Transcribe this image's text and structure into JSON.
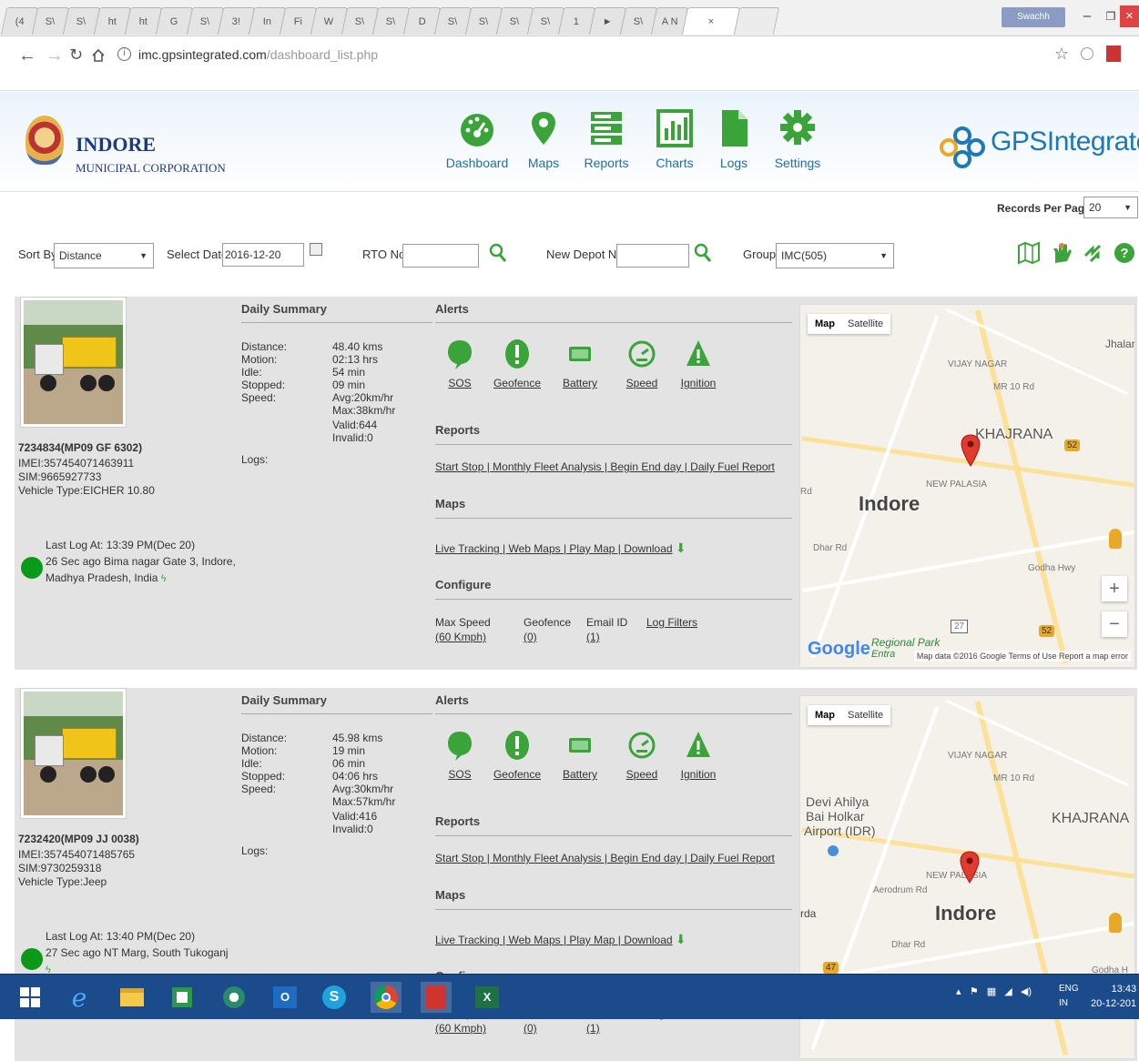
{
  "browser": {
    "tabs": [
      "(4",
      "S\\",
      "S\\",
      "ht",
      "ht",
      "G",
      "S\\",
      "3!",
      "In",
      "Fi",
      "W",
      "S\\",
      "S\\",
      "D",
      "S\\",
      "S\\",
      "S\\",
      "S\\",
      "1",
      "►",
      "S\\",
      "A N",
      "×"
    ],
    "profile": "Swachh",
    "url_host": "imc.gpsintegrated.com",
    "url_path": "/dashboard_list.php"
  },
  "header": {
    "org_title": "INDORE",
    "org_subtitle": "MUNICIPAL CORPORATION",
    "nav": [
      "Dashboard",
      "Maps",
      "Reports",
      "Charts",
      "Logs",
      "Settings"
    ],
    "brand": "GPSIntegrated",
    "nav_color": "#1f6fa6",
    "icon_color": "#3aa43a"
  },
  "toolbar": {
    "records_per_page_label": "Records Per Page:",
    "records_per_page_value": "20",
    "sort_by_label": "Sort By",
    "sort_by_value": "Distance",
    "select_date_label": "Select Date",
    "select_date_value": "2016-12-20",
    "rto_label": "RTO No",
    "depot_label": "New Depot No",
    "group_label": "Group",
    "group_value": "IMC(505)"
  },
  "vehicles": [
    {
      "id": "7234834(MP09 GF 6302)",
      "imei": "IMEI:357454071463911",
      "sim": "SIM:9665927733",
      "type": "Vehicle Type:EICHER 10.80",
      "last_log": "Last Log At: 13:39 PM(Dec 20)",
      "last_loc1": "26 Sec ago Bima nagar Gate 3, Indore,",
      "last_loc2": "Madhya Pradesh, India",
      "summary": {
        "distance": "48.40 kms",
        "motion": "02:13 hrs",
        "idle": "54 min",
        "stopped": "09 min",
        "speed_avg": "Avg:20km/hr",
        "speed_max": "Max:38km/hr",
        "logs_valid": "Valid:644",
        "logs_invalid": "Invalid:0"
      },
      "map": {
        "city": "Indore",
        "areas": [
          "KHAJRANA",
          "Jhalariya"
        ],
        "small": [
          "VIJAY NAGAR",
          "MR 10 Rd",
          "NEW PALASIA",
          "Godha Hwy",
          "Dhar Rd",
          "Rd"
        ],
        "park": "Regional Park",
        "park2": "Entra",
        "badges": [
          "52",
          "27",
          "52"
        ],
        "attribution": "Map data ©2016 Google   Terms of Use   Report a map error"
      }
    },
    {
      "id": "7232420(MP09 JJ 0038)",
      "imei": "IMEI:357454071485765",
      "sim": "SIM:9730259318",
      "type": "Vehicle Type:Jeep",
      "last_log": "Last Log At: 13:40 PM(Dec 20)",
      "last_loc1": "27 Sec ago NT Marg, South Tukoganj",
      "last_loc2": "",
      "summary": {
        "distance": "45.98 kms",
        "motion": "19 min",
        "idle": "06 min",
        "stopped": "04:06 hrs",
        "speed_avg": "Avg:30km/hr",
        "speed_max": "Max:57km/hr",
        "logs_valid": "Valid:416",
        "logs_invalid": "Invalid:0"
      },
      "map": {
        "city": "Indore",
        "areas": [
          "KHAJRANA",
          "Devi Ahilya",
          "Bai Holkar",
          "Airport (IDR)"
        ],
        "small": [
          "VIJAY NAGAR",
          "MR 10 Rd",
          "NEW PALASIA",
          "Aerodrum Rd",
          "Dhar Rd",
          "rda",
          "Godha H"
        ],
        "badges": [
          "47"
        ]
      }
    }
  ],
  "labels": {
    "daily_summary": "Daily Summary",
    "distance": "Distance:",
    "motion": "Motion:",
    "idle": "Idle:",
    "stopped": "Stopped:",
    "speed": "Speed:",
    "logs": "Logs:",
    "alerts": "Alerts",
    "alert_items": [
      "SOS",
      "Geofence",
      "Battery",
      "Speed",
      "Ignition"
    ],
    "reports": "Reports",
    "report_links": "Start Stop | Monthly Fleet Analysis | Begin End day | Daily Fuel Report",
    "maps": "Maps",
    "map_links": "Live Tracking | Web Maps | Play Map | Download",
    "configure": "Configure",
    "max_speed": "Max Speed",
    "max_speed_val": "(60 Kmph)",
    "geofence": "Geofence",
    "geofence_val": "(0)",
    "email": "Email ID",
    "email_val": "(1)",
    "log_filters": "Log Filters",
    "map_type_map": "Map",
    "map_type_sat": "Satellite",
    "google": "Google"
  },
  "taskbar": {
    "lang1": "ENG",
    "lang2": "IN",
    "time": "13:43",
    "date": "20-12-201"
  }
}
